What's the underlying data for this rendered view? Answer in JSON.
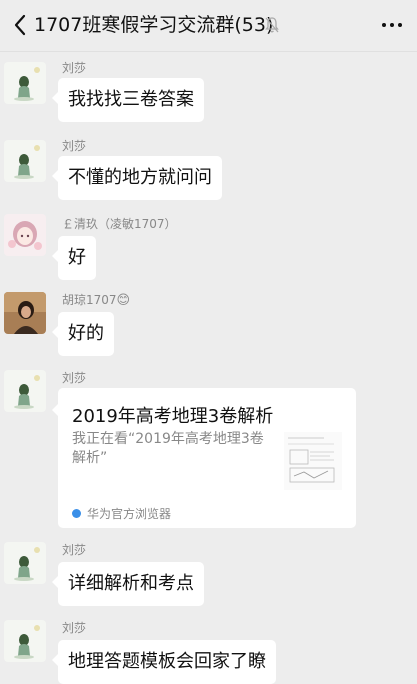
{
  "header": {
    "title": "1707班寒假学习交流群(53)",
    "back_icon": "chevron-left-icon",
    "mute_icon": "bell-muted-icon",
    "more_icon": "more-dots-icon"
  },
  "messages": [
    {
      "sender": "刘莎",
      "text": "我找找三卷答案"
    },
    {
      "sender": "刘莎",
      "text": "不懂的地方就问问"
    },
    {
      "sender": "￡清玖（凌敏1707）",
      "text": "好"
    },
    {
      "sender": "胡琼1707",
      "sender_emoji": "😊",
      "text": "好的"
    },
    {
      "sender": "刘莎",
      "card": {
        "title": "2019年高考地理3卷解析",
        "description": "我正在看“2019年高考地理3卷解析”",
        "source": "华为官方浏览器"
      }
    },
    {
      "sender": "刘莎",
      "text": "详细解析和考点"
    },
    {
      "sender": "刘莎",
      "text": "地理答题模板会回家了瞭"
    }
  ],
  "colors": {
    "background": "#ededed",
    "bubble": "#ffffff",
    "sender_text": "#888888",
    "source_icon": "#3a8fe8"
  }
}
